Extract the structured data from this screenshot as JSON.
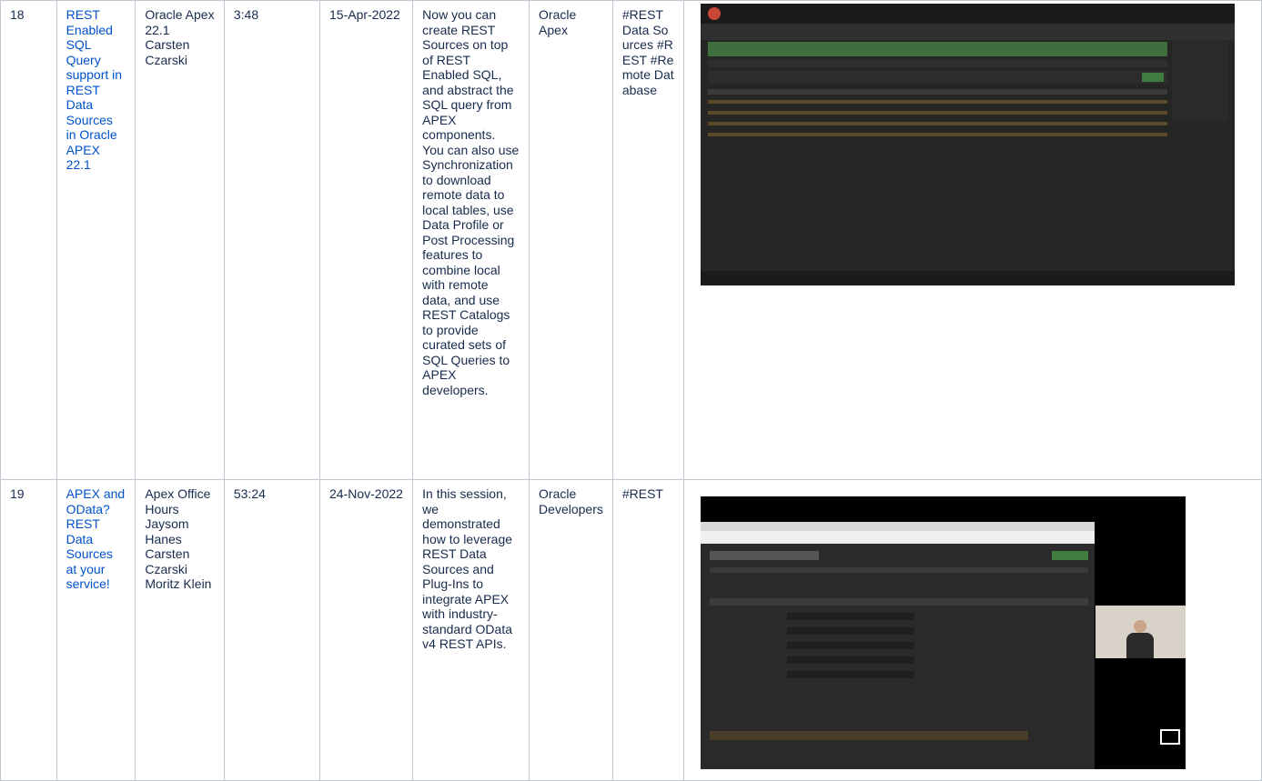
{
  "rows": [
    {
      "num": "18",
      "title": "REST Enabled SQL Query support in REST Data Sources in Oracle APEX 22.1",
      "presenters": "Oracle Apex 22.1 Carsten Czarski",
      "duration": "3:48",
      "date": "15-Apr-2022",
      "description": "Now you can create REST Sources on top of REST Enabled SQL, and abstract the SQL query from APEX components. You can also use Synchronization to download remote data to local tables, use Data Profile or Post Processing features to combine local with remote data, and use REST Catalogs to provide curated sets of SQL Queries to APEX developers.",
      "channel": "Oracle Apex",
      "tags": "#REST Data Sources #REST #Remote Database"
    },
    {
      "num": "19",
      "title": "APEX and OData? REST Data Sources at your service!",
      "presenters": "Apex Office Hours Jaysom Hanes Carsten Czarski Moritz Klein",
      "duration": "53:24",
      "date": "24-Nov-2022",
      "description": "In this session, we demonstrated how to leverage REST Data Sources and Plug-Ins to integrate APEX with industry-standard OData v4 REST APIs.",
      "channel": "Oracle Developers",
      "tags": "#REST"
    }
  ]
}
